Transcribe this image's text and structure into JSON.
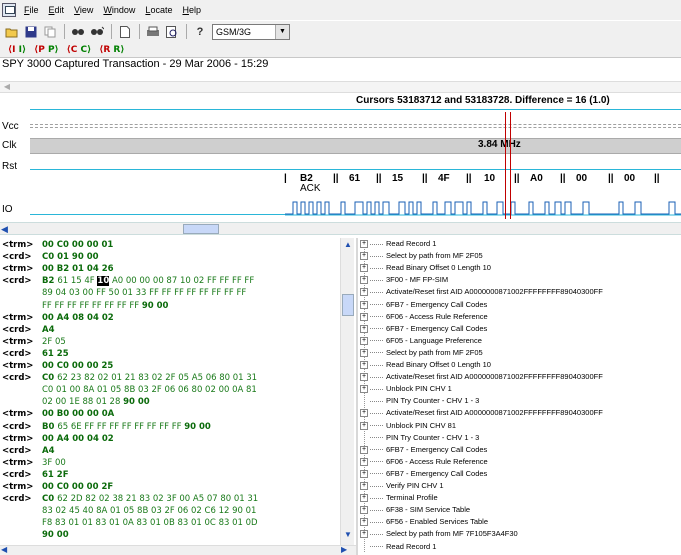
{
  "menu": [
    "File",
    "Edit",
    "View",
    "Window",
    "Locate",
    "Help"
  ],
  "toolbar": {
    "icons": [
      "open-folder-icon",
      "save-icon",
      "copy-icon",
      "find-icon",
      "find-next-icon",
      "page-icon",
      "print-icon",
      "print-preview-icon",
      "help-icon"
    ],
    "protocol_select": "GSM/3G"
  },
  "navbar": [
    {
      "left": "⟨I",
      "right": "I⟩"
    },
    {
      "left": "⟨P",
      "right": "P⟩"
    },
    {
      "left": "⟨C",
      "right": "C⟩"
    },
    {
      "left": "⟨R",
      "right": "R⟩"
    }
  ],
  "title": "SPY 3000 Captured Transaction - 29 Mar 2006 - 15:29",
  "waveform": {
    "cursors": "Cursors 53183712 and 53183728.  Difference = 16 (1.0)",
    "signals": [
      "Vcc",
      "Clk",
      "Rst",
      "IO"
    ],
    "clk_freq": "3.84 MHz",
    "io_bytes": [
      "B2",
      "61",
      "15",
      "4F",
      "10",
      "A0",
      "00",
      "00"
    ],
    "io_ack": "ACK",
    "io_sep": "||"
  },
  "transactions": [
    {
      "tag": "<trm>",
      "parts": [
        {
          "t": "00 C0 00 00 01",
          "s": "hl-bold"
        }
      ]
    },
    {
      "tag": "<crd>",
      "parts": [
        {
          "t": "C0 01 ",
          "s": "hl-bold"
        },
        {
          "t": "90 00",
          "s": "hl-bold"
        }
      ]
    },
    {
      "tag": "<trm>",
      "parts": [
        {
          "t": "00 B2 01 04 26",
          "s": "hl-bold"
        }
      ]
    },
    {
      "tag": "<crd>",
      "parts": [
        {
          "t": "B2 ",
          "s": "hl-bold"
        },
        {
          "t": "61 15 4F ",
          "s": "data"
        },
        {
          "t": "10",
          "s": "inv"
        },
        {
          "t": " A0 00 00 00 87 10 02 FF FF FF FF",
          "s": "data"
        }
      ]
    },
    {
      "tag": "",
      "parts": [
        {
          "t": "89 04 03 00 FF 50 01 33 FF FF FF FF FF FF FF FF",
          "s": "data"
        }
      ]
    },
    {
      "tag": "",
      "parts": [
        {
          "t": "FF FF FF FF FF FF FF FF ",
          "s": "data"
        },
        {
          "t": "90 00",
          "s": "hl-bold"
        }
      ]
    },
    {
      "tag": "<trm>",
      "parts": [
        {
          "t": "00 A4 08 04 02",
          "s": "hl-bold"
        }
      ]
    },
    {
      "tag": "<crd>",
      "parts": [
        {
          "t": "A4",
          "s": "hl-bold"
        }
      ]
    },
    {
      "tag": "<trm>",
      "parts": [
        {
          "t": "2F 05",
          "s": "data"
        }
      ]
    },
    {
      "tag": "<crd>",
      "parts": [
        {
          "t": "61 25",
          "s": "hl-bold"
        }
      ]
    },
    {
      "tag": "<trm>",
      "parts": [
        {
          "t": "00 C0 00 00 25",
          "s": "hl-bold"
        }
      ]
    },
    {
      "tag": "<crd>",
      "parts": [
        {
          "t": "C0 ",
          "s": "hl-bold"
        },
        {
          "t": "62 23 82 02 01 21 83 02 2F 05 A5 06 80 01 31",
          "s": "data"
        }
      ]
    },
    {
      "tag": "",
      "parts": [
        {
          "t": "C0 01 00 8A 01 05 8B 03 2F 06 06 80 02 00 0A 81",
          "s": "data"
        }
      ]
    },
    {
      "tag": "",
      "parts": [
        {
          "t": "02 00 1E 88 01 28 ",
          "s": "data"
        },
        {
          "t": "90 00",
          "s": "hl-bold"
        }
      ]
    },
    {
      "tag": "<trm>",
      "parts": [
        {
          "t": "00 B0 00 00 0A",
          "s": "hl-bold"
        }
      ]
    },
    {
      "tag": "<crd>",
      "parts": [
        {
          "t": "B0 ",
          "s": "hl-bold"
        },
        {
          "t": "65 6E FF FF FF FF FF FF FF FF ",
          "s": "data"
        },
        {
          "t": "90 00",
          "s": "hl-bold"
        }
      ]
    },
    {
      "tag": "<trm>",
      "parts": [
        {
          "t": "00 A4 00 04 02",
          "s": "hl-bold"
        }
      ]
    },
    {
      "tag": "<crd>",
      "parts": [
        {
          "t": "A4",
          "s": "hl-bold"
        }
      ]
    },
    {
      "tag": "<trm>",
      "parts": [
        {
          "t": "3F 00",
          "s": "data"
        }
      ]
    },
    {
      "tag": "<crd>",
      "parts": [
        {
          "t": "61 2F",
          "s": "hl-bold"
        }
      ]
    },
    {
      "tag": "<trm>",
      "parts": [
        {
          "t": "00 C0 00 00 2F",
          "s": "hl-bold"
        }
      ]
    },
    {
      "tag": "<crd>",
      "parts": [
        {
          "t": "C0 ",
          "s": "hl-bold"
        },
        {
          "t": "62 2D 82 02 38 21 83 02 3F 00 A5 07 80 01 31",
          "s": "data"
        }
      ]
    },
    {
      "tag": "",
      "parts": [
        {
          "t": "83 02 45 40 8A 01 05 8B 03 2F 06 02 C6 12 90 01",
          "s": "data"
        }
      ]
    },
    {
      "tag": "",
      "parts": [
        {
          "t": "F8 83 01 01 83 01 0A 83 01 0B 83 01 0C 83 01 0D",
          "s": "data"
        }
      ]
    },
    {
      "tag": "",
      "parts": [
        {
          "t": "90 00",
          "s": "hl-bold"
        }
      ]
    }
  ],
  "tree": [
    {
      "label": "Read Record 1",
      "exp": true
    },
    {
      "label": "Select by path from MF 2F05",
      "exp": true
    },
    {
      "label": "Read Binary Offset 0 Length 10",
      "exp": true
    },
    {
      "label": "3F00 - MF FP-SIM",
      "exp": true
    },
    {
      "label": "Activate/Reset first AID A0000000871002FFFFFFFF89040300FF",
      "exp": true
    },
    {
      "label": "6FB7 - Emergency Call Codes",
      "exp": true
    },
    {
      "label": "6F06 - Access Rule Reference",
      "exp": true
    },
    {
      "label": "6FB7 - Emergency Call Codes",
      "exp": true
    },
    {
      "label": "6F05 - Language Preference",
      "exp": true
    },
    {
      "label": "Select by path from MF 2F05",
      "exp": true
    },
    {
      "label": "Read Binary Offset 0 Length 10",
      "exp": true
    },
    {
      "label": "Activate/Reset first AID A0000000871002FFFFFFFF89040300FF",
      "exp": true
    },
    {
      "label": "Unblock PIN CHV 1",
      "exp": true
    },
    {
      "label": "PIN Try Counter - CHV 1 - 3",
      "exp": false
    },
    {
      "label": "Activate/Reset first AID A0000000871002FFFFFFFF89040300FF",
      "exp": true
    },
    {
      "label": "Unblock PIN CHV 81",
      "exp": true
    },
    {
      "label": "PIN Try Counter - CHV 1 - 3",
      "exp": false
    },
    {
      "label": "6FB7 - Emergency Call Codes",
      "exp": true
    },
    {
      "label": "6F06 - Access Rule Reference",
      "exp": true
    },
    {
      "label": "6FB7 - Emergency Call Codes",
      "exp": true
    },
    {
      "label": "Verify PIN CHV 1",
      "exp": true
    },
    {
      "label": "Terminal Profile",
      "exp": true
    },
    {
      "label": "6F38 - SIM Service Table",
      "exp": true
    },
    {
      "label": "6F56 - Enabled Services Table",
      "exp": true
    },
    {
      "label": "Select by path from MF 7F105F3A4F30",
      "exp": true
    },
    {
      "label": "Read Record 1",
      "exp": false
    }
  ]
}
